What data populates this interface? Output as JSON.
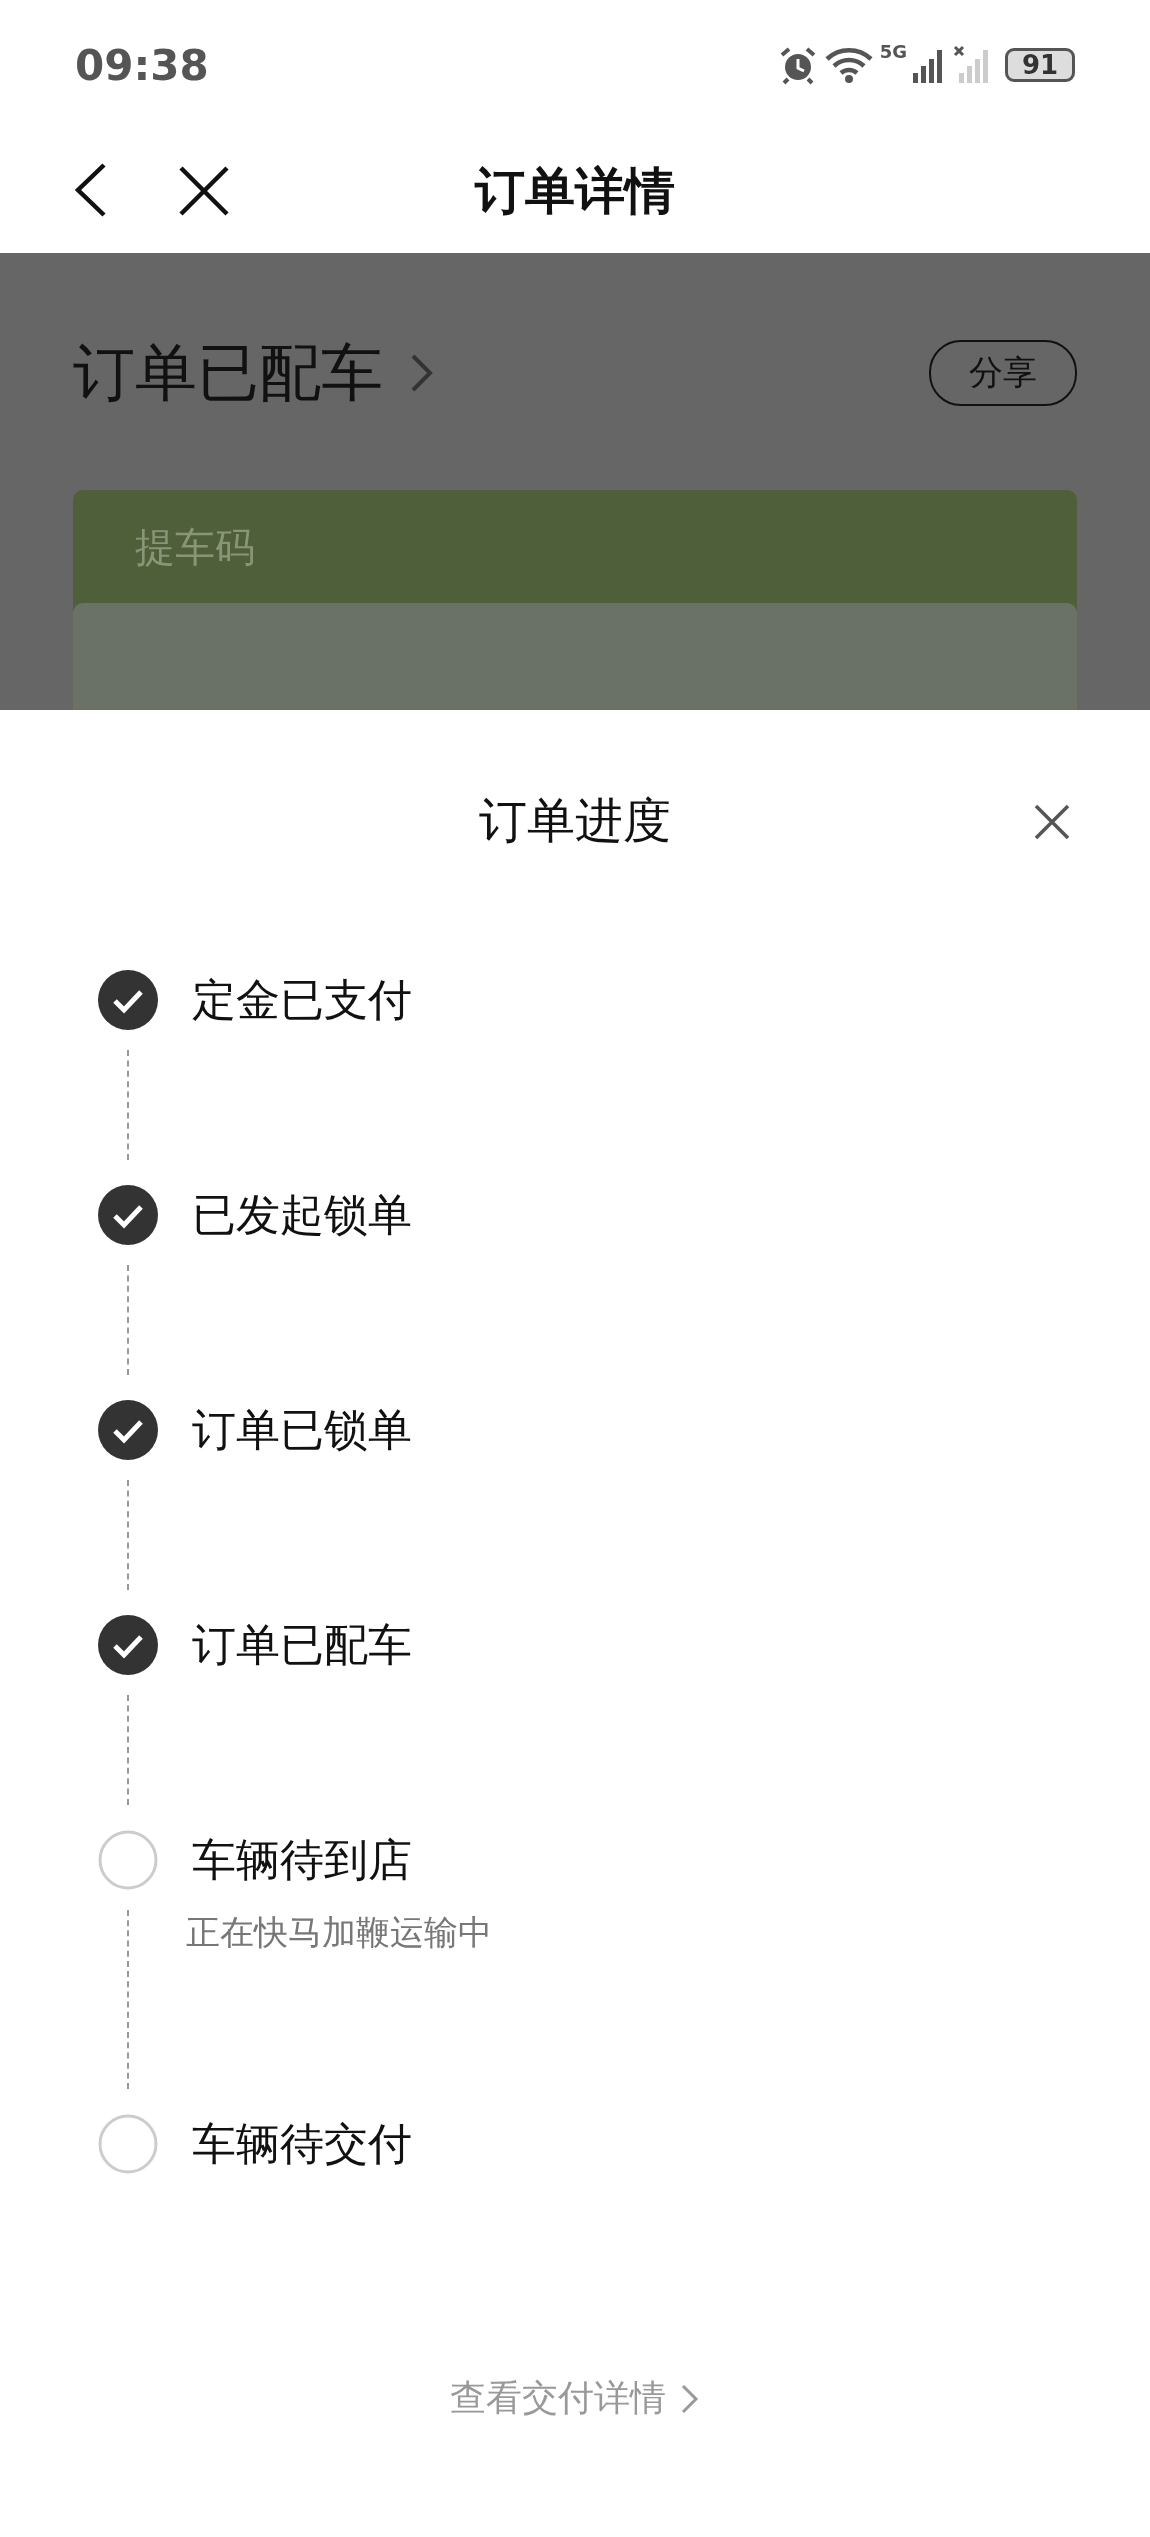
{
  "status_bar": {
    "time": "09:38",
    "network": "5G",
    "battery": "91"
  },
  "nav": {
    "title": "订单详情"
  },
  "background_page": {
    "status": "订单已配车",
    "share_button": "分享",
    "pickup_card": {
      "label": "提车码"
    }
  },
  "sheet": {
    "title": "订单进度",
    "steps": [
      {
        "label": "定金已支付",
        "done": true
      },
      {
        "label": "已发起锁单",
        "done": true
      },
      {
        "label": "订单已锁单",
        "done": true
      },
      {
        "label": "订单已配车",
        "done": true
      },
      {
        "label": "车辆待到店",
        "done": false,
        "note": "正在快马加鞭运输中"
      },
      {
        "label": "车辆待交付",
        "done": false
      }
    ],
    "footer_link": "查看交付详情"
  }
}
